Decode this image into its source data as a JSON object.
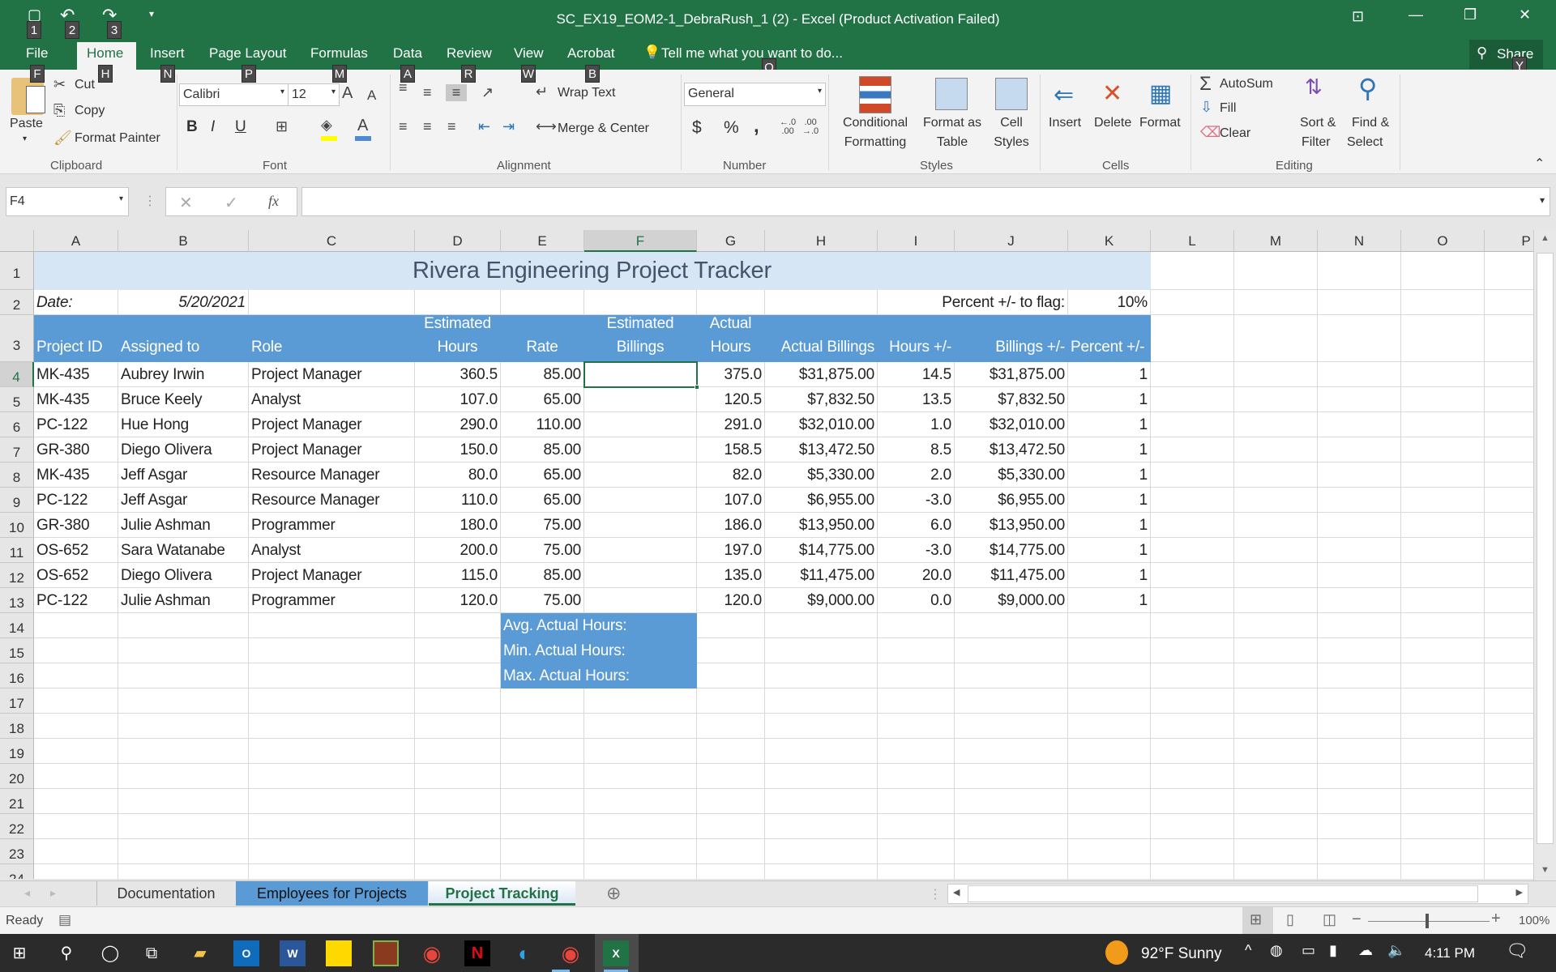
{
  "window": {
    "title": "SC_EX19_EOM2-1_DebraRush_1 (2) - Excel (Product Activation Failed)"
  },
  "ribbon_tabs": [
    "File",
    "Home",
    "Insert",
    "Page Layout",
    "Formulas",
    "Data",
    "Review",
    "View",
    "Acrobat"
  ],
  "active_tab": "Home",
  "tell_me": "Tell me what you want to do...",
  "share": "Share",
  "keytips": {
    "qat": [
      "1",
      "2",
      "3"
    ],
    "tabs": [
      "F",
      "H",
      "N",
      "P",
      "M",
      "A",
      "R",
      "W",
      "B"
    ],
    "tell": "Q",
    "share": "Y"
  },
  "clipboard": {
    "paste": "Paste",
    "cut": "Cut",
    "copy": "Copy",
    "format_painter": "Format Painter",
    "label": "Clipboard"
  },
  "font": {
    "name": "Calibri",
    "size": "12",
    "bold": "B",
    "italic": "I",
    "underline": "U",
    "label": "Font"
  },
  "alignment": {
    "wrap": "Wrap Text",
    "merge": "Merge & Center",
    "label": "Alignment"
  },
  "number": {
    "format": "General",
    "currency": "$",
    "percent": "%",
    "comma": ",",
    "label": "Number"
  },
  "styles": {
    "cond1": "Conditional",
    "cond2": "Formatting",
    "fmt1": "Format as",
    "fmt2": "Table",
    "cell1": "Cell",
    "cell2": "Styles",
    "label": "Styles"
  },
  "cells": {
    "insert": "Insert",
    "delete": "Delete",
    "format": "Format",
    "label": "Cells"
  },
  "editing": {
    "autosum": "AutoSum",
    "fill": "Fill",
    "clear": "Clear",
    "sort1": "Sort &",
    "sort2": "Filter",
    "find1": "Find &",
    "find2": "Select",
    "label": "Editing"
  },
  "formula_bar": {
    "name_box": "F4",
    "formula": "",
    "fx": "fx"
  },
  "columns": [
    "A",
    "B",
    "C",
    "D",
    "E",
    "F",
    "G",
    "H",
    "I",
    "J",
    "K",
    "L",
    "M",
    "N",
    "O",
    "P"
  ],
  "selected_cell": "F4",
  "sheet": {
    "title": "Rivera Engineering Project Tracker",
    "date_label": "Date:",
    "date_value": "5/20/2021",
    "flag_label": "Percent +/- to flag:",
    "flag_value": "10%",
    "headers": [
      [
        "",
        "Project ID"
      ],
      [
        "",
        "Assigned to"
      ],
      [
        "",
        "Role"
      ],
      [
        "Estimated",
        "Hours"
      ],
      [
        "",
        "Rate"
      ],
      [
        "Estimated",
        "Billings"
      ],
      [
        "Actual",
        "Hours"
      ],
      [
        "",
        "Actual Billings"
      ],
      [
        "",
        "Hours +/-"
      ],
      [
        "",
        "Billings +/-"
      ],
      [
        "",
        "Percent +/-"
      ]
    ],
    "rows": [
      [
        "MK-435",
        "Aubrey Irwin",
        "Project Manager",
        "360.5",
        "85.00",
        "",
        "375.0",
        "$31,875.00",
        "14.5",
        "$31,875.00",
        "1"
      ],
      [
        "MK-435",
        "Bruce Keely",
        "Analyst",
        "107.0",
        "65.00",
        "",
        "120.5",
        "$7,832.50",
        "13.5",
        "$7,832.50",
        "1"
      ],
      [
        "PC-122",
        "Hue Hong",
        "Project Manager",
        "290.0",
        "110.00",
        "",
        "291.0",
        "$32,010.00",
        "1.0",
        "$32,010.00",
        "1"
      ],
      [
        "GR-380",
        "Diego Olivera",
        "Project Manager",
        "150.0",
        "85.00",
        "",
        "158.5",
        "$13,472.50",
        "8.5",
        "$13,472.50",
        "1"
      ],
      [
        "MK-435",
        "Jeff Asgar",
        "Resource Manager",
        "80.0",
        "65.00",
        "",
        "82.0",
        "$5,330.00",
        "2.0",
        "$5,330.00",
        "1"
      ],
      [
        "PC-122",
        "Jeff Asgar",
        "Resource Manager",
        "110.0",
        "65.00",
        "",
        "107.0",
        "$6,955.00",
        "-3.0",
        "$6,955.00",
        "1"
      ],
      [
        "GR-380",
        "Julie Ashman",
        "Programmer",
        "180.0",
        "75.00",
        "",
        "186.0",
        "$13,950.00",
        "6.0",
        "$13,950.00",
        "1"
      ],
      [
        "OS-652",
        "Sara Watanabe",
        "Analyst",
        "200.0",
        "75.00",
        "",
        "197.0",
        "$14,775.00",
        "-3.0",
        "$14,775.00",
        "1"
      ],
      [
        "OS-652",
        "Diego Olivera",
        "Project Manager",
        "115.0",
        "85.00",
        "",
        "135.0",
        "$11,475.00",
        "20.0",
        "$11,475.00",
        "1"
      ],
      [
        "PC-122",
        "Julie Ashman",
        "Programmer",
        "120.0",
        "75.00",
        "",
        "120.0",
        "$9,000.00",
        "0.0",
        "$9,000.00",
        "1"
      ]
    ],
    "stats": [
      "Avg. Actual Hours:",
      "Min. Actual Hours:",
      "Max. Actual Hours:"
    ]
  },
  "sheet_tabs": [
    "Documentation",
    "Employees for Projects",
    "Project Tracking"
  ],
  "active_sheet": "Project Tracking",
  "status": {
    "ready": "Ready",
    "zoom": "100%"
  },
  "taskbar": {
    "weather": "92°F  Sunny",
    "time": "4:11 PM"
  },
  "colors": {
    "excel_green": "#217346",
    "header_blue": "#5b9bd5",
    "title_fill": "#d6e6f5",
    "tab_blue": "#5b9bd5"
  }
}
